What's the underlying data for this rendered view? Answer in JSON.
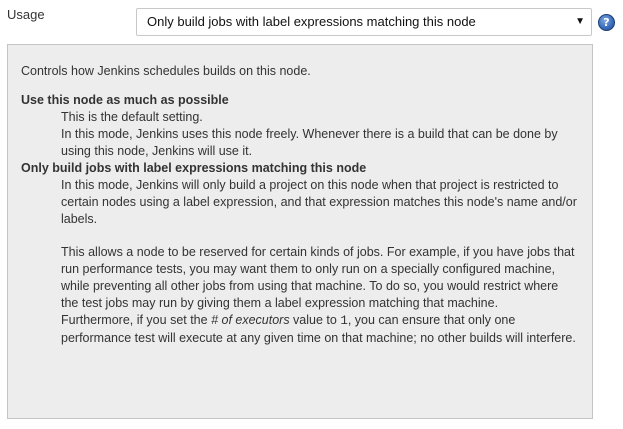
{
  "usage": {
    "label": "Usage",
    "selected": "Only build jobs with label expressions matching this node",
    "arrow_glyph": "▼",
    "help_icon_glyph": "?"
  },
  "help": {
    "intro": "Controls how Jenkins schedules builds on this node.",
    "options": [
      {
        "title": "Use this node as much as possible",
        "lines": [
          "This is the default setting.",
          "In this mode, Jenkins uses this node freely. Whenever there is a build that can be done by using this node, Jenkins will use it."
        ]
      },
      {
        "title": "Only build jobs with label expressions matching this node",
        "para1": "In this mode, Jenkins will only build a project on this node when that project is restricted to certain nodes using a label expression, and that expression matches this node's name and/or labels.",
        "para2": "This allows a node to be reserved for certain kinds of jobs. For example, if you have jobs that run performance tests, you may want them to only run on a specially configured machine, while preventing all other jobs from using that machine. To do so, you would restrict where the test jobs may run by giving them a label expression matching that machine.",
        "para3_before": "Furthermore, if you set the ",
        "para3_em": "# of executors",
        "para3_mid": " value to ",
        "para3_code": "1",
        "para3_after": ", you can ensure that only one performance test will execute at any given time on that machine; no other builds will interfere."
      }
    ]
  }
}
